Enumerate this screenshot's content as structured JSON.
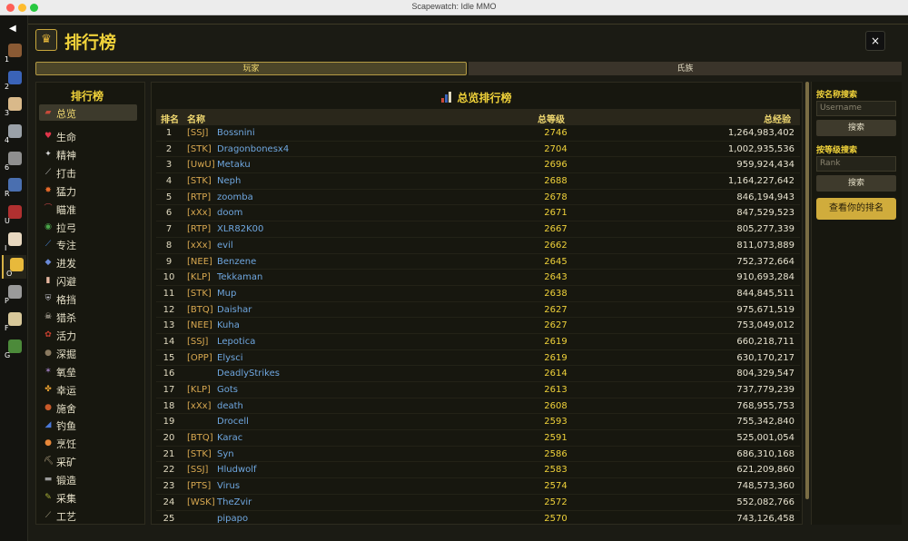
{
  "window": {
    "title": "Scapewatch: Idle MMO"
  },
  "nav": {
    "collapse_icon": "◀",
    "items": [
      {
        "key": "1",
        "icon": "chest-icon",
        "color": "#8a5a34"
      },
      {
        "key": "2",
        "icon": "stats-icon",
        "color": "#3a63b8"
      },
      {
        "key": "3",
        "icon": "scroll-icon",
        "color": "#d9b98a"
      },
      {
        "key": "4",
        "icon": "crossed-swords-icon",
        "color": "#9aa1a8"
      },
      {
        "key": "6",
        "icon": "anvil-icon",
        "color": "#8f8f8f"
      },
      {
        "key": "R",
        "icon": "spellbook-icon",
        "color": "#4a6fb0"
      },
      {
        "key": "U",
        "icon": "shop-icon",
        "color": "#b03030"
      },
      {
        "key": "I",
        "icon": "bank-icon",
        "color": "#e8d8c0"
      },
      {
        "key": "O",
        "icon": "crown-icon",
        "color": "#e8b93b"
      },
      {
        "key": "P",
        "icon": "gear-icon",
        "color": "#9a9a9a"
      },
      {
        "key": "F",
        "icon": "magnifier-icon",
        "color": "#d8c89a"
      },
      {
        "key": "G",
        "icon": "wreath-icon",
        "color": "#4c8a3a"
      }
    ]
  },
  "header": {
    "title": "排行榜",
    "crown_glyph": "♛",
    "close_label": "×"
  },
  "tabs": {
    "players": "玩家",
    "clans": "氏族"
  },
  "categories": {
    "title": "排行榜",
    "items": [
      {
        "label": "总览",
        "glyph": "▰",
        "color": "#c84a3a"
      },
      {
        "label": "生命",
        "glyph": "♥",
        "color": "#e0354a"
      },
      {
        "label": "精神",
        "glyph": "✦",
        "color": "#d8d8d8"
      },
      {
        "label": "打击",
        "glyph": "⟋",
        "color": "#c0c0c0"
      },
      {
        "label": "猛力",
        "glyph": "✸",
        "color": "#e86a2a"
      },
      {
        "label": "瞄准",
        "glyph": "⌒",
        "color": "#b04040"
      },
      {
        "label": "拉弓",
        "glyph": "◉",
        "color": "#4aa64a"
      },
      {
        "label": "专注",
        "glyph": "⟋",
        "color": "#4a8ae0"
      },
      {
        "label": "进发",
        "glyph": "◆",
        "color": "#6a8ad8"
      },
      {
        "label": "闪避",
        "glyph": "▮",
        "color": "#e8b8a0"
      },
      {
        "label": "格挡",
        "glyph": "⛨",
        "color": "#c0c0c8"
      },
      {
        "label": "猎杀",
        "glyph": "☠",
        "color": "#e8e0d0"
      },
      {
        "label": "活力",
        "glyph": "✿",
        "color": "#c84030"
      },
      {
        "label": "深掘",
        "glyph": "●",
        "color": "#8a7a60"
      },
      {
        "label": "氧垒",
        "glyph": "✶",
        "color": "#9a7ab8"
      },
      {
        "label": "幸运",
        "glyph": "✤",
        "color": "#e8a030"
      },
      {
        "label": "施舍",
        "glyph": "●",
        "color": "#c85a2a"
      },
      {
        "label": "钓鱼",
        "glyph": "◢",
        "color": "#4a78d8"
      },
      {
        "label": "烹饪",
        "glyph": "●",
        "color": "#e8883a"
      },
      {
        "label": "采矿",
        "glyph": "⛏",
        "color": "#b0a080"
      },
      {
        "label": "锻造",
        "glyph": "▬",
        "color": "#9a9a9a"
      },
      {
        "label": "采集",
        "glyph": "✎",
        "color": "#a8b038"
      },
      {
        "label": "工艺",
        "glyph": "⟋",
        "color": "#b0a888"
      }
    ]
  },
  "leaderboard": {
    "title": "总览排行榜",
    "columns": {
      "rank": "排名",
      "name": "名称",
      "level": "总等级",
      "xp": "总经验"
    },
    "rows": [
      {
        "rank": "1",
        "tag": "[SSJ]",
        "name": "Bossnini",
        "level": "2746",
        "xp": "1,264,983,402"
      },
      {
        "rank": "2",
        "tag": "[STK]",
        "name": "Dragonbonesx4",
        "level": "2704",
        "xp": "1,002,935,536"
      },
      {
        "rank": "3",
        "tag": "[UwU]",
        "name": "Metaku",
        "level": "2696",
        "xp": "959,924,434"
      },
      {
        "rank": "4",
        "tag": "[STK]",
        "name": "Neph",
        "level": "2688",
        "xp": "1,164,227,642"
      },
      {
        "rank": "5",
        "tag": "[RTP]",
        "name": "zoomba",
        "level": "2678",
        "xp": "846,194,943"
      },
      {
        "rank": "6",
        "tag": "[xXx]",
        "name": "doom",
        "level": "2671",
        "xp": "847,529,523"
      },
      {
        "rank": "7",
        "tag": "[RTP]",
        "name": "XLR82K00",
        "level": "2667",
        "xp": "805,277,339"
      },
      {
        "rank": "8",
        "tag": "[xXx]",
        "name": "evil",
        "level": "2662",
        "xp": "811,073,889"
      },
      {
        "rank": "9",
        "tag": "[NEE]",
        "name": "Benzene",
        "level": "2645",
        "xp": "752,372,664"
      },
      {
        "rank": "10",
        "tag": "[KLP]",
        "name": "Tekkaman",
        "level": "2643",
        "xp": "910,693,284"
      },
      {
        "rank": "11",
        "tag": "[STK]",
        "name": "Mup",
        "level": "2638",
        "xp": "844,845,511"
      },
      {
        "rank": "12",
        "tag": "[BTQ]",
        "name": "Daishar",
        "level": "2627",
        "xp": "975,671,519"
      },
      {
        "rank": "13",
        "tag": "[NEE]",
        "name": "Kuha",
        "level": "2627",
        "xp": "753,049,012"
      },
      {
        "rank": "14",
        "tag": "[SSJ]",
        "name": "Lepotica",
        "level": "2619",
        "xp": "660,218,711"
      },
      {
        "rank": "15",
        "tag": "[OPP]",
        "name": "Elysci",
        "level": "2619",
        "xp": "630,170,217"
      },
      {
        "rank": "16",
        "tag": "",
        "name": "DeadlyStrikes",
        "level": "2614",
        "xp": "804,329,547"
      },
      {
        "rank": "17",
        "tag": "[KLP]",
        "name": "Gots",
        "level": "2613",
        "xp": "737,779,239"
      },
      {
        "rank": "18",
        "tag": "[xXx]",
        "name": "death",
        "level": "2608",
        "xp": "768,955,753"
      },
      {
        "rank": "19",
        "tag": "",
        "name": "Drocell",
        "level": "2593",
        "xp": "755,342,840"
      },
      {
        "rank": "20",
        "tag": "[BTQ]",
        "name": "Karac",
        "level": "2591",
        "xp": "525,001,054"
      },
      {
        "rank": "21",
        "tag": "[STK]",
        "name": "Syn",
        "level": "2586",
        "xp": "686,310,168"
      },
      {
        "rank": "22",
        "tag": "[SSJ]",
        "name": "Hludwolf",
        "level": "2583",
        "xp": "621,209,860"
      },
      {
        "rank": "23",
        "tag": "[PTS]",
        "name": "Virus",
        "level": "2574",
        "xp": "748,573,360"
      },
      {
        "rank": "24",
        "tag": "[WSK]",
        "name": "TheZvir",
        "level": "2572",
        "xp": "552,082,766"
      },
      {
        "rank": "25",
        "tag": "",
        "name": "pipapo",
        "level": "2570",
        "xp": "743,126,458"
      }
    ]
  },
  "search": {
    "by_name_label": "按名称搜索",
    "name_placeholder": "Username",
    "name_button": "搜索",
    "by_rank_label": "按等级搜索",
    "rank_placeholder": "Rank",
    "rank_button": "搜索",
    "my_rank_button": "查看你的排名"
  }
}
